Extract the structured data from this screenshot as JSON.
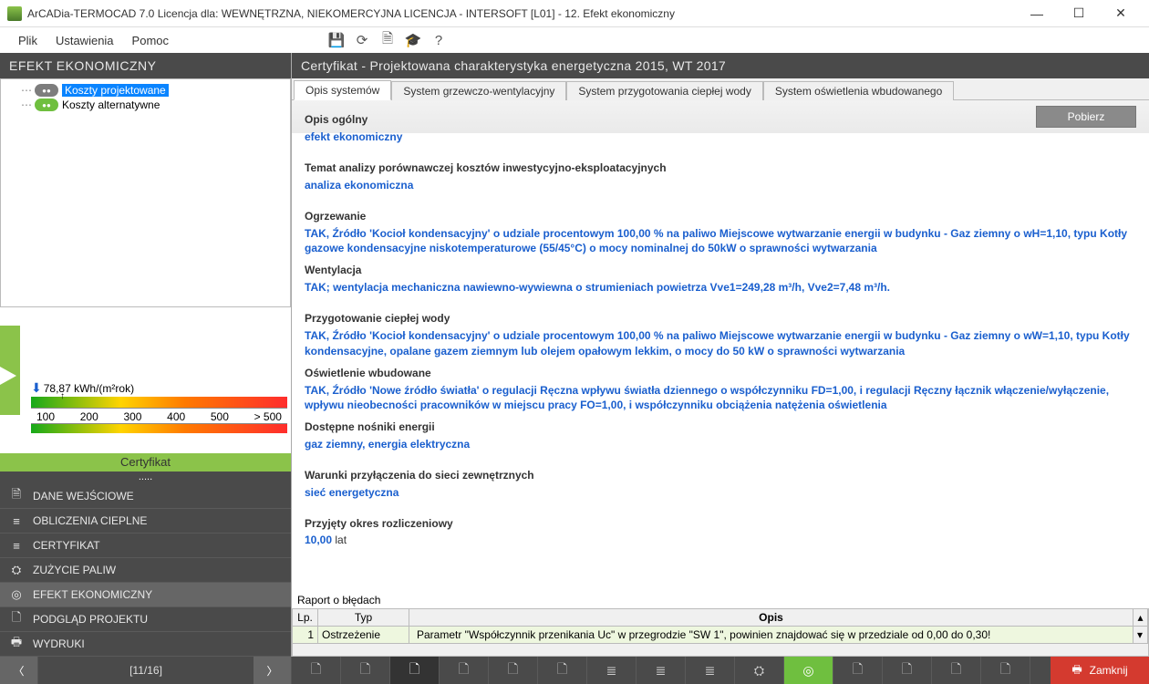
{
  "window": {
    "title": "ArCADia-TERMOCAD 7.0 Licencja dla: WEWNĘTRZNA, NIEKOMERCYJNA LICENCJA - INTERSOFT [L01] - 12. Efekt ekonomiczny"
  },
  "menu": {
    "plik": "Plik",
    "ustawienia": "Ustawienia",
    "pomoc": "Pomoc"
  },
  "left": {
    "header": "EFEKT EKONOMICZNY",
    "tree": {
      "item1": "Koszty projektowane",
      "item2": "Koszty alternatywne"
    },
    "gauge": {
      "value": "78,87 kWh/(m²rok)",
      "ticks": {
        "t1": "100",
        "t2": "200",
        "t3": "300",
        "t4": "400",
        "t5": "500",
        "t6": "> 500"
      }
    },
    "cert": "Certyfikat",
    "dots": ".....",
    "nav": {
      "n1": "DANE WEJŚCIOWE",
      "n2": "OBLICZENIA CIEPLNE",
      "n3": "CERTYFIKAT",
      "n4": "ZUŻYCIE PALIW",
      "n5": "EFEKT EKONOMICZNY",
      "n6": "PODGLĄD PROJEKTU",
      "n7": "WYDRUKI"
    }
  },
  "right": {
    "header": "Certyfikat - Projektowana charakterystyka energetyczna 2015, WT 2017",
    "tabs": {
      "t1": "Opis systemów",
      "t2": "System grzewczo-wentylacyjny",
      "t3": "System przygotowania ciepłej wody",
      "t4": "System oświetlenia wbudowanego"
    },
    "pobierz": "Pobierz",
    "fields": {
      "l1": "Opis ogólny",
      "v1": "efekt ekonomiczny",
      "l2": "Temat analizy porównawczej kosztów inwestycyjno-eksploatacyjnych",
      "v2": "analiza ekonomiczna",
      "l3": "Ogrzewanie",
      "v3": "TAK, Źródło 'Kocioł kondensacyjny' o udziale procentowym 100,00 % na paliwo Miejscowe wytwarzanie energii w budynku - Gaz ziemny o wH=1,10, typu Kotły gazowe kondensacyjne niskotemperaturowe (55/45°C) o mocy nominalnej do 50kW o sprawności wytwarzania",
      "l4": "Wentylacja",
      "v4": "TAK; wentylacja mechaniczna nawiewno-wywiewna o strumieniach powietrza Vve1=249,28 m³/h, Vve2=7,48 m³/h.",
      "l5": "Przygotowanie ciepłej wody",
      "v5": "TAK, Źródło 'Kocioł kondensacyjny' o udziale procentowym 100,00 % na paliwo Miejscowe wytwarzanie energii w budynku - Gaz ziemny o wW=1,10, typu Kotły kondensacyjne, opalane gazem ziemnym lub olejem opałowym lekkim, o mocy do 50 kW o sprawności wytwarzania",
      "l6": "Oświetlenie wbudowane",
      "v6": "TAK, Źródło 'Nowe źródło światła' o regulacji Ręczna wpływu światła dziennego o współczynniku FD=1,00, i regulacji Ręczny łącznik włączenie/wyłączenie, wpływu nieobecności pracowników w miejscu pracy FO=1,00, i współczynniku obciążenia natężenia oświetlenia",
      "l7": "Dostępne nośniki energii",
      "v7": "gaz ziemny, energia elektryczna",
      "l8": "Warunki przyłączenia do sieci zewnętrznych",
      "v8": "sieć energetyczna",
      "l9": "Przyjęty okres rozliczeniowy",
      "v9a": "10,00",
      "v9b": " lat"
    },
    "errors": {
      "title": "Raport o błędach",
      "head_lp": "Lp.",
      "head_typ": "Typ",
      "head_opis": "Opis",
      "row1_lp": "1",
      "row1_typ": "Ostrzeżenie",
      "row1_opis": "Parametr \"Współczynnik przenikania Uc\" w przegrodzie \"SW 1\", powinien znajdować się w przedziale od 0,00 do 0,30!"
    }
  },
  "footer": {
    "page": "[11/16]",
    "close": "Zamknij"
  }
}
